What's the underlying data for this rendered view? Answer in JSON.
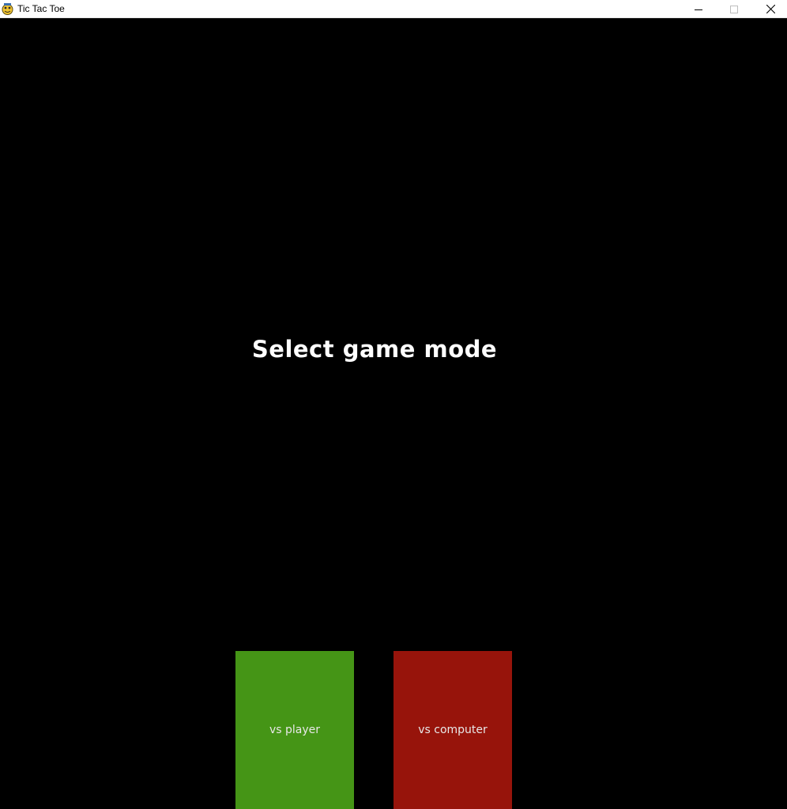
{
  "window": {
    "title": "Tic Tac Toe",
    "icon": "pygame-snake-icon",
    "controls": {
      "minimize_icon": "minimize-icon",
      "maximize_icon": "maximize-icon",
      "close_icon": "close-icon"
    }
  },
  "menu": {
    "heading": "Select game mode",
    "buttons": [
      {
        "label": "vs player",
        "color": "#459516"
      },
      {
        "label": "vs computer",
        "color": "#97140b"
      }
    ]
  },
  "colors": {
    "background": "#000000",
    "text": "#ffffff"
  }
}
